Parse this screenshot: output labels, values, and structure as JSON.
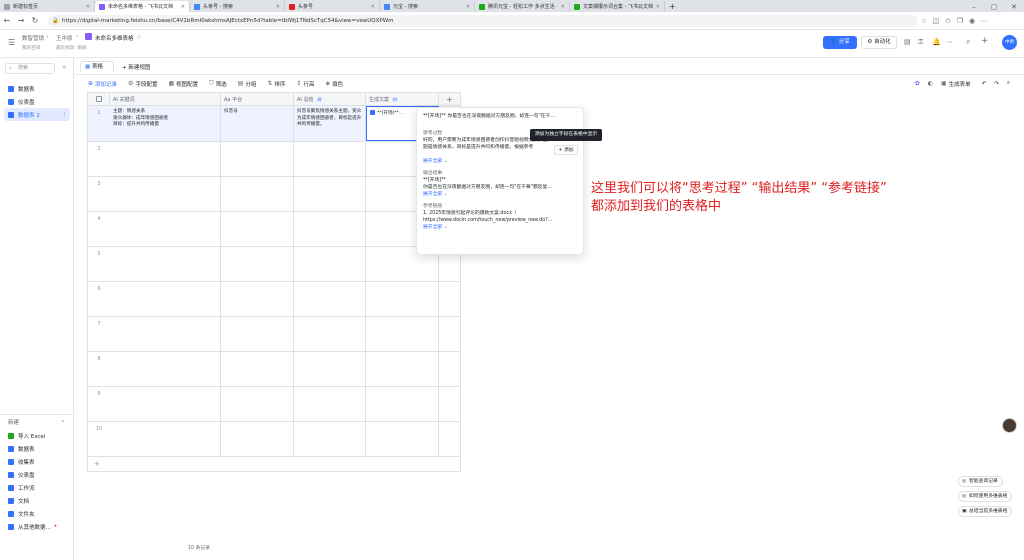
{
  "browser": {
    "tabs": [
      {
        "label": "新建标签页",
        "color": "#9aa0a6",
        "active": false
      },
      {
        "label": "未命名多维表格 - 飞书云文档",
        "color": "#8a5cf6",
        "active": true
      },
      {
        "label": "头条号 - 搜索",
        "color": "#4285f4",
        "active": false
      },
      {
        "label": "头条号",
        "color": "#e02020",
        "active": false
      },
      {
        "label": "元宝 - 搜索",
        "color": "#4285f4",
        "active": false
      },
      {
        "label": "腾讯元宝 - 轻松工作 多点生活",
        "color": "#1aad19",
        "active": false
      },
      {
        "label": "文案偶攥示词合集 - 飞书云文档",
        "color": "#1aad19",
        "active": false
      }
    ],
    "url": "https://digital-marketing.feishu.cn/base/C4V1bRmI0akshmsAJEctxEPn5d?table=tblWj1TNdScTqC54&view=vewUQXPWm"
  },
  "app_header": {
    "breadcrumb_1": "数智营销",
    "breadcrumb_2": "王中原",
    "doc_title": "未命名多维表格",
    "sub_1": "我的空间",
    "sub_2": "最近修改: 刚刚",
    "share_label": "分享",
    "automation_label": "自动化",
    "avatar_text": "中原"
  },
  "sidebar": {
    "search_placeholder": "搜索",
    "items": [
      {
        "label": "数据表",
        "selected": false
      },
      {
        "label": "仪表盘",
        "selected": false
      },
      {
        "label": "数据表 2",
        "selected": true
      }
    ],
    "new_label": "新建",
    "new_items": [
      {
        "label": "导入 Excel",
        "color": "#1aad19"
      },
      {
        "label": "数据表",
        "color": "#3370ff"
      },
      {
        "label": "收集表",
        "color": "#3370ff"
      },
      {
        "label": "仪表盘",
        "color": "#3370ff"
      },
      {
        "label": "工作流",
        "color": "#3370ff"
      },
      {
        "label": "文档",
        "color": "#3370ff"
      },
      {
        "label": "文件夹",
        "color": "#3370ff"
      },
      {
        "label": "从其他数据...",
        "color": "#3370ff"
      }
    ]
  },
  "view_tabs": {
    "current_view": "表格",
    "new_view": "新建视图"
  },
  "toolbar": {
    "add_record": "添加记录",
    "field_config": "字段配置",
    "view_config": "视图配置",
    "filter": "筛选",
    "group": "分组",
    "sort": "排序",
    "row_height": "行高",
    "fill_color": "填色",
    "generate_form": "生成表单"
  },
  "grid": {
    "columns": [
      {
        "label": "AI 关键词"
      },
      {
        "label": "Aa 平台"
      },
      {
        "label": "AI 总结"
      },
      {
        "label": "生成文案"
      }
    ],
    "row1": {
      "keyword": "主题：情感关系\n受众群体：成年情感困惑者\n目标：提升共鸣传播量",
      "platform": "抖音号",
      "summary": "抖音号聚焦情感关系主题，受众为成年情感困惑者，目标是提升共鸣传播量。",
      "copy": "**[开场]**..."
    },
    "row_numbers": [
      "1",
      "2",
      "3",
      "4",
      "5",
      "6",
      "7",
      "8",
      "9",
      "10"
    ],
    "record_count": "10 条记录"
  },
  "popup": {
    "headline": "**[开场]** 你是否也在深夜翻遍对方朋友圈，却连一句\"在干...",
    "thinking_title": "思考过程",
    "thinking_text": "好的，用户需要为成年情感困惑者创作抖音短视频文案，主题是情感关系，目标是提升共鸣和传播量。根据参考",
    "expand_1": "展开全部",
    "output_title": "输出结果",
    "output_text_1": "**[开场]**",
    "output_text_2": "你是否也在深夜翻遍对方朋友圈，却连一句\"在干嘛\"都反复...",
    "expand_2": "展开全部",
    "ref_title": "参考链接",
    "ref_text_1": "1. 2025年情感引起评论的爆款文案.docx（",
    "ref_text_2": "https://www.docin.com/touch_new/preview_new.do?...",
    "expand_3": "展开全部",
    "tooltip": "添加为独立字段在表格中显示",
    "add_button": "+ 添加"
  },
  "annotation": {
    "line1": "这里我们可以将“思考过程” “输出结果” “参考链接”",
    "line2": "都添加到我们的表格中"
  },
  "right_buttons": [
    "智能查询记录",
    "如何使用多维表格",
    "总结当前多维表格"
  ]
}
